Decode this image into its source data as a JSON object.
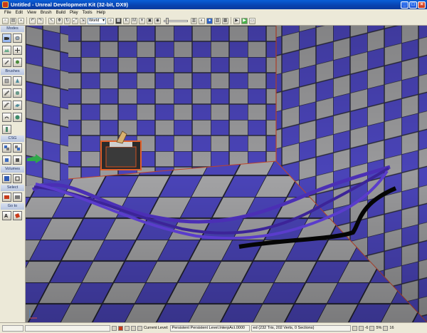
{
  "window": {
    "title": "Untitled - Unreal Development Kit (32-bit, DX9)"
  },
  "menus": [
    "File",
    "Edit",
    "View",
    "Brush",
    "Build",
    "Play",
    "Tools",
    "Help"
  ],
  "toolbar": {
    "coordinate_system": "World"
  },
  "sidebar": {
    "modes_label": "Modes",
    "brushes_label": "Brushes",
    "csg_label": "CSG",
    "volumes_label": "Volumes",
    "select_label": "Select",
    "goto_label": "Go to"
  },
  "status": {
    "level_label": "Current Level:",
    "level_value": "Persistent Persistent Level.InterpAct.0000",
    "stats": "ed (232 Tris, 202 Verts, 0 Sections)",
    "snap_value": "-6",
    "percent": "5%",
    "grid_value": "16"
  },
  "colors": {
    "tile_blue": "#4a44b8",
    "tile_grey": "#9a9a9c",
    "rail": "#4b2fb5",
    "titlebar": "#0a49c4"
  }
}
